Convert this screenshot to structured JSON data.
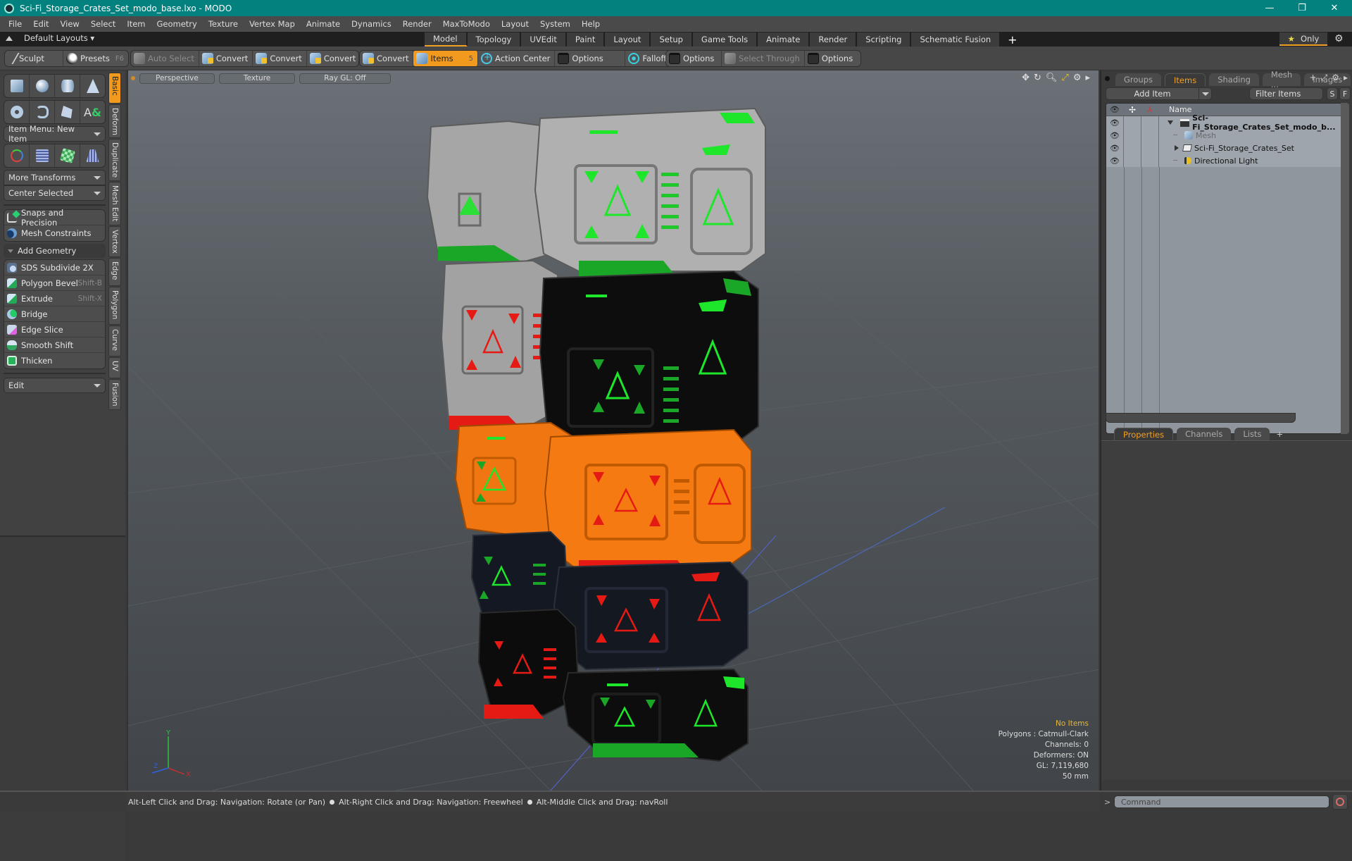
{
  "window": {
    "title": "Sci-Fi_Storage_Crates_Set_modo_base.lxo - MODO",
    "controls": [
      "minimize-icon",
      "restore-icon",
      "close-icon"
    ]
  },
  "menu": [
    "File",
    "Edit",
    "View",
    "Select",
    "Item",
    "Geometry",
    "Texture",
    "Vertex Map",
    "Animate",
    "Dynamics",
    "Render",
    "MaxToModo",
    "Layout",
    "System",
    "Help"
  ],
  "layout_bar": {
    "layouts_dropdown": "Default Layouts ▾",
    "tabs": [
      "Model",
      "Topology",
      "UVEdit",
      "Paint",
      "Layout",
      "Setup",
      "Game Tools",
      "Animate",
      "Render",
      "Scripting",
      "Schematic Fusion"
    ],
    "active_tab": "Model",
    "add_tab": "+",
    "only_button": "Only"
  },
  "toolbar": {
    "sculpt": "Sculpt",
    "presets": "Presets",
    "presets_hotkey": "F6",
    "auto_select": "Auto Select",
    "convert_buttons": [
      "Convert",
      "Convert",
      "Convert",
      "Convert"
    ],
    "items": "Items",
    "items_hotkey": "5",
    "action_center": "Action Center",
    "options1": "Options",
    "falloff": "Falloff",
    "options2": "Options",
    "select_through": "Select Through",
    "options3": "Options"
  },
  "left_panel": {
    "primitive_icons_row1": [
      "cube-icon",
      "sphere-icon",
      "cylinder-icon",
      "cone-icon"
    ],
    "primitive_icons_row2": [
      "torus-icon",
      "spiral-icon",
      "pen-icon",
      "text-icon"
    ],
    "item_menu": "Item Menu: New Item",
    "transform_icons": [
      "transform-gizmo-icon",
      "grid-deform-icon",
      "checker-uv-icon",
      "taper-icon"
    ],
    "more_transforms": "More Transforms",
    "center_selected": "Center Selected",
    "snaps": "Snaps and Precision",
    "mesh_constraints": "Mesh Constraints",
    "add_geometry": "Add Geometry",
    "tools": [
      {
        "label": "SDS Subdivide 2X",
        "hotkey": ""
      },
      {
        "label": "Polygon Bevel",
        "hotkey": "Shift-B"
      },
      {
        "label": "Extrude",
        "hotkey": "Shift-X"
      },
      {
        "label": "Bridge",
        "hotkey": ""
      },
      {
        "label": "Edge Slice",
        "hotkey": ""
      },
      {
        "label": "Smooth Shift",
        "hotkey": ""
      },
      {
        "label": "Thicken",
        "hotkey": ""
      }
    ],
    "edit_dropdown": "Edit",
    "vertical_tabs": [
      "Basic",
      "Deform",
      "Duplicate",
      "Mesh Edit",
      "Vertex",
      "Edge",
      "Polygon",
      "Curve",
      "UV",
      "Fusion"
    ],
    "active_vertical_tab": "Basic"
  },
  "viewport": {
    "view_mode": "Perspective",
    "shading": "Texture",
    "raygl": "Ray GL: Off",
    "info": {
      "selection": "No Items",
      "polygons": "Polygons : Catmull-Clark",
      "channels": "Channels: 0",
      "deformers": "Deformers: ON",
      "gl": "GL: 7,119,680",
      "scale": "50 mm"
    },
    "axis_labels": {
      "x": "X",
      "y": "Y",
      "z": "Z"
    },
    "crate_colors": {
      "gray_body": "#a9a9a9",
      "black_body": "#0c0c0c",
      "orange_body": "#f07810",
      "navy_body": "#141820",
      "green_accent": "#1ee62a",
      "red_accent": "#e61a14"
    }
  },
  "right_panel": {
    "tabs": [
      "Groups",
      "Items",
      "Shading",
      "Mesh ...",
      "Images"
    ],
    "active_tab": "Items",
    "add_item": "Add Item",
    "filter_placeholder": "Filter Items",
    "s_button": "S",
    "f_button": "F",
    "column_name": "Name",
    "items": [
      {
        "name": "Sci-Fi_Storage_Crates_Set_modo_b...",
        "type": "scene",
        "expanded": true
      },
      {
        "name": "Mesh",
        "type": "mesh",
        "dim": true
      },
      {
        "name": "Sci-Fi_Storage_Crates_Set",
        "type": "group",
        "expanded": false
      },
      {
        "name": "Directional Light",
        "type": "light"
      }
    ],
    "bottom_tabs": [
      "Properties",
      "Channels",
      "Lists"
    ],
    "active_bottom_tab": "Properties"
  },
  "status_bar": {
    "hints": [
      "Alt-Left Click and Drag: Navigation: Rotate (or Pan)",
      "Alt-Right Click and Drag: Navigation: Freewheel",
      "Alt-Middle Click and Drag: navRoll"
    ],
    "command_placeholder": "Command",
    "prompt": ">"
  }
}
